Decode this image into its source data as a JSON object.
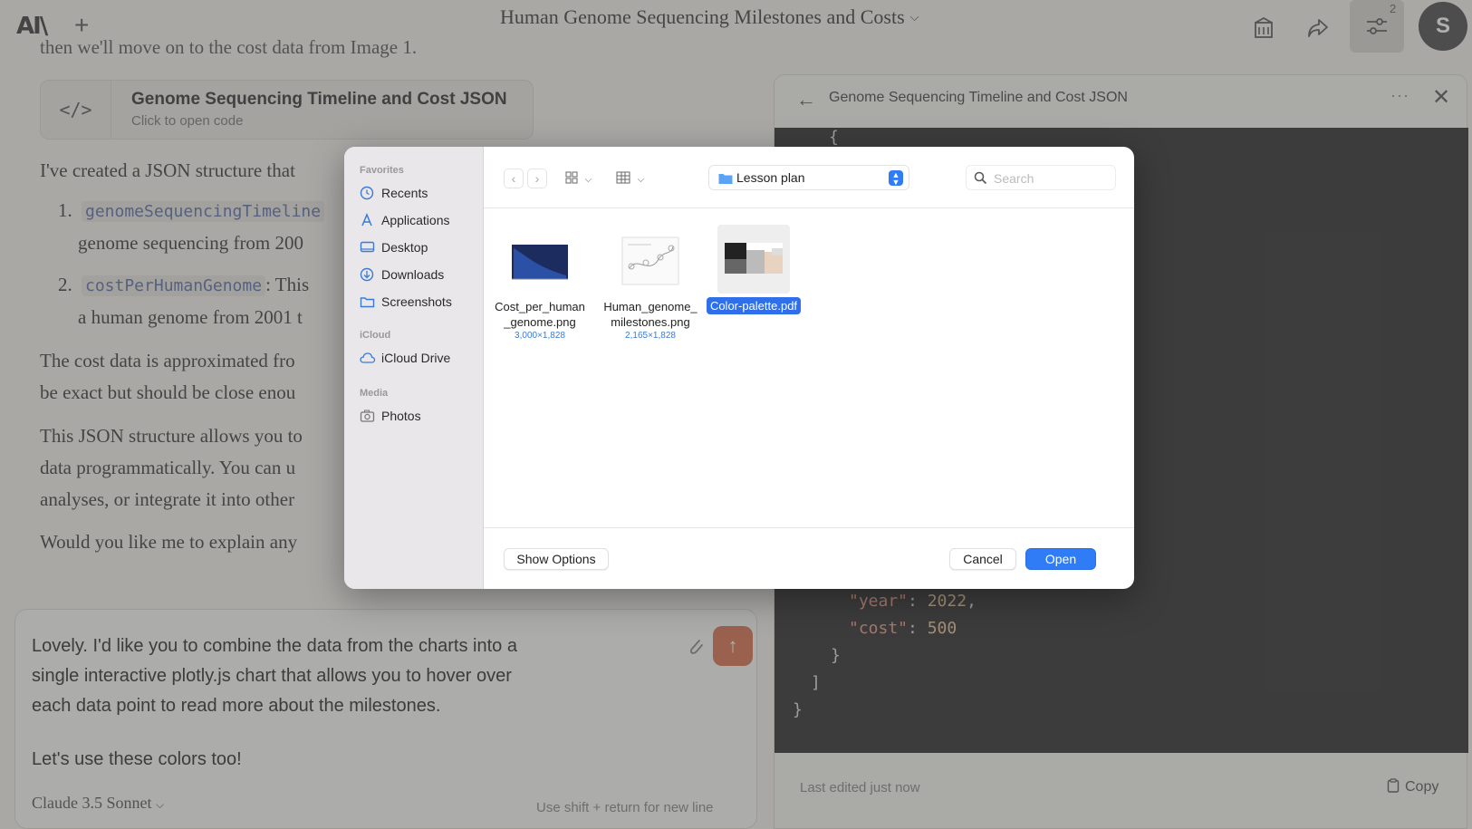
{
  "topbar": {
    "logo": "AI\\",
    "new_chat": "+",
    "title": "Human Genome Sequencing Milestones and Costs",
    "notification_count": "2",
    "avatar_letter": "S"
  },
  "chat": {
    "cut_line": "then we'll move on to the cost data from Image 1.",
    "artifact": {
      "icon": "</>",
      "title": "Genome Sequencing Timeline and Cost JSON",
      "subtitle": "Click to open code"
    },
    "para1": "I've created a JSON structure that",
    "list": [
      {
        "num": "1.",
        "code": "genomeSequencingTimeline",
        "text": "genome sequencing from 200"
      },
      {
        "num": "2.",
        "code": "costPerHumanGenome",
        "after": ": This",
        "text": "a human genome from 2001 t"
      }
    ],
    "para2a": "The cost data is approximated fro",
    "para2b": "be exact but should be close enou",
    "para3a": "This JSON structure allows you to",
    "para3b": "data programmatically. You can u",
    "para3c": "analyses, or integrate it into other",
    "para4": "Would you like me to explain any"
  },
  "input": {
    "prompt": "Lovely. I'd like you to combine the data from the charts into a\nsingle interactive plotly.js chart that allows you to hover over\neach data point to read more about the milestones.",
    "prompt_line2": "Let's use these colors too!",
    "model": "Claude 3.5 Sonnet",
    "hint": "Use  shift + return  for new line"
  },
  "panel": {
    "title": "Genome Sequencing Timeline and Cost JSON",
    "code_open": "{",
    "year_key": "\"year\"",
    "year_val": "2022",
    "cost_key": "\"cost\"",
    "cost_val": "500",
    "brace": "}",
    "bracket": "]",
    "brace_end": "}",
    "edited": "Last edited just now",
    "copy": "Copy"
  },
  "dialog": {
    "sections": {
      "favorites": "Favorites",
      "icloud": "iCloud",
      "media": "Media"
    },
    "favorites": [
      "Recents",
      "Applications",
      "Desktop",
      "Downloads",
      "Screenshots"
    ],
    "icloud_items": [
      "iCloud Drive"
    ],
    "media_items": [
      "Photos"
    ],
    "location": "Lesson plan",
    "search_placeholder": "Search",
    "files": [
      {
        "name_line1": "Cost_per_human",
        "name_line2": "_genome.png",
        "dims": "3,000×1,828"
      },
      {
        "name_line1": "Human_genome_",
        "name_line2": "milestones.png",
        "dims": "2,165×1,828"
      },
      {
        "name": "Color-palette.pdf"
      }
    ],
    "show_options": "Show Options",
    "cancel": "Cancel",
    "open": "Open"
  }
}
